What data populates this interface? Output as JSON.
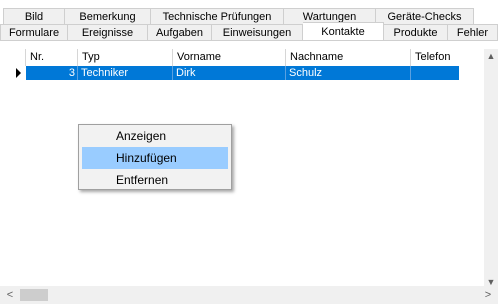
{
  "tabs_back": [
    "Bild",
    "Bemerkung",
    "Technische Prüfungen",
    "Wartungen",
    "Geräte-Checks"
  ],
  "tabs_front": [
    "Formulare",
    "Ereignisse",
    "Aufgaben",
    "Einweisungen",
    "Kontakte",
    "Produkte",
    "Fehler"
  ],
  "active_tab": "Kontakte",
  "grid": {
    "columns": [
      "Nr.",
      "Typ",
      "Vorname",
      "Nachname",
      "Telefon"
    ],
    "rows": [
      {
        "nr": "3",
        "typ": "Techniker",
        "vorname": "Dirk",
        "nachname": "Schulz",
        "telefon": ""
      }
    ],
    "selected_row_color": "#0078d7"
  },
  "context_menu": {
    "items": [
      "Anzeigen",
      "Hinzufügen",
      "Entfernen"
    ],
    "highlighted": "Hinzufügen",
    "highlight_color": "#99ccff"
  },
  "icons": {
    "scroll_up": "▲",
    "scroll_down": "▼",
    "scroll_left": "<",
    "scroll_right": ">",
    "row_pointer": "row-pointer-icon"
  }
}
